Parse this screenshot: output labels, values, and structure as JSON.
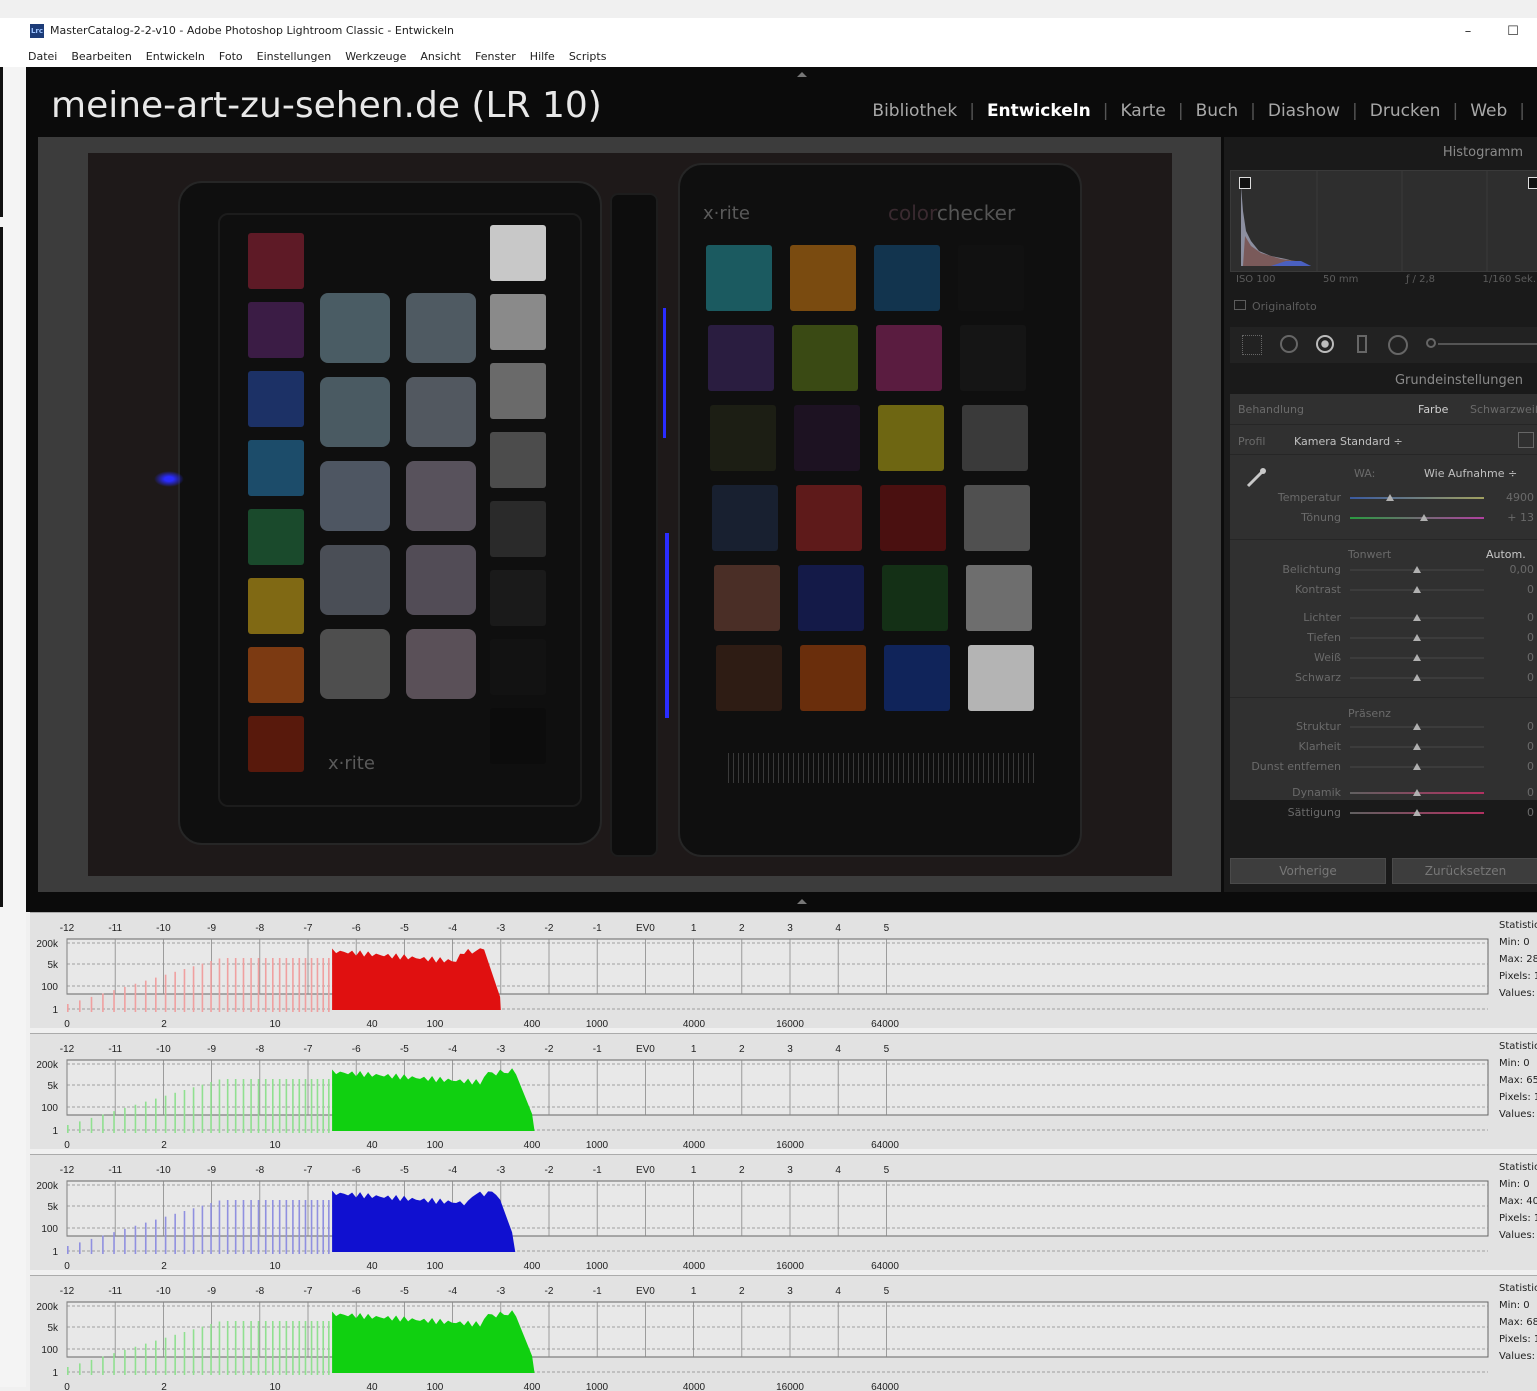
{
  "window": {
    "title": "MasterCatalog-2-2-v10 - Adobe Photoshop Lightroom Classic - Entwickeln",
    "app_icon_text": "Lrc",
    "minimize_glyph": "–",
    "maximize_glyph": "☐"
  },
  "menu": [
    "Datei",
    "Bearbeiten",
    "Entwickeln",
    "Foto",
    "Einstellungen",
    "Werkzeuge",
    "Ansicht",
    "Fenster",
    "Hilfe",
    "Scripts"
  ],
  "identity_plate": "meine-art-zu-sehen.de (LR 10)",
  "modules": [
    {
      "label": "Bibliothek",
      "active": false
    },
    {
      "label": "Entwickeln",
      "active": true
    },
    {
      "label": "Karte",
      "active": false
    },
    {
      "label": "Buch",
      "active": false
    },
    {
      "label": "Diashow",
      "active": false
    },
    {
      "label": "Drucken",
      "active": false
    },
    {
      "label": "Web",
      "active": false
    }
  ],
  "photo": {
    "brand_left": "x·rite",
    "brand_right_a": "color",
    "brand_right_b": "checker",
    "left_card_colors": [
      "#5e1a26",
      "#3b1c45",
      "#1c3166",
      "#1c4c6a",
      "#1a4a2c",
      "#806914",
      "#7c3a12",
      "#58190c"
    ],
    "left_card_grays": [
      "#c8c8c8",
      "#8a8a8a",
      "#6a6a6a",
      "#4c4c4c",
      "#2a2a2a",
      "#1a1a1a",
      "#121212",
      "#0c0c0c"
    ],
    "right_card_colors": [
      [
        "#1b5a60",
        "#7a4b10",
        "#12344e",
        "#111111"
      ],
      [
        "#2a1d40",
        "#3a4a14",
        "#5a1c40",
        "#151515"
      ],
      [
        "#1c1e14",
        "#1d1222",
        "#6e6612",
        "#3a3a3a"
      ],
      [
        "#182030",
        "#5e1a1a",
        "#4a1010",
        "#505050"
      ],
      [
        "#4a2e26",
        "#141a48",
        "#143016",
        "#6e6e6e"
      ],
      [
        "#2e1c14",
        "#6a2e0c",
        "#10245a",
        "#b4b4b4"
      ]
    ]
  },
  "histogram_panel": {
    "title": "Histogramm",
    "info": [
      "ISO 100",
      "50 mm",
      "ƒ / 2,8",
      "1/160 Sek."
    ],
    "original_photo": "Originalfoto"
  },
  "basic_panel": {
    "title": "Grundeinstellungen",
    "treatment_label": "Behandlung",
    "treatment_color": "Farbe",
    "treatment_bw": "Schwarzweiß",
    "profile_label": "Profil",
    "profile_value": "Kamera Standard ÷",
    "wb_label": "WA:",
    "wb_value": "Wie Aufnahme ÷",
    "tone_label": "Tonwert",
    "auto_label": "Autom.",
    "presence_label": "Präsenz",
    "sliders": [
      {
        "label": "Temperatur",
        "value": "4900",
        "pos": 0.3
      },
      {
        "label": "Tönung",
        "value": "+ 13",
        "pos": 0.55
      },
      {
        "label": "Belichtung",
        "value": "0,00",
        "pos": 0.5
      },
      {
        "label": "Kontrast",
        "value": "0",
        "pos": 0.5
      },
      {
        "label": "Lichter",
        "value": "0",
        "pos": 0.5
      },
      {
        "label": "Tiefen",
        "value": "0",
        "pos": 0.5
      },
      {
        "label": "Weiß",
        "value": "0",
        "pos": 0.5
      },
      {
        "label": "Schwarz",
        "value": "0",
        "pos": 0.5
      },
      {
        "label": "Struktur",
        "value": "0",
        "pos": 0.5
      },
      {
        "label": "Klarheit",
        "value": "0",
        "pos": 0.5
      },
      {
        "label": "Dunst entfernen",
        "value": "0",
        "pos": 0.5
      },
      {
        "label": "Dynamik",
        "value": "0",
        "pos": 0.5
      },
      {
        "label": "Sättigung",
        "value": "0",
        "pos": 0.5
      }
    ],
    "previous_button": "Vorherige",
    "reset_button": "Zurücksetzen"
  },
  "histograms": {
    "ev_ticks": [
      "-12",
      "-11",
      "-10",
      "-9",
      "-8",
      "-7",
      "-6",
      "-5",
      "-4",
      "-3",
      "-2",
      "-1",
      "EV0",
      "1",
      "2",
      "3",
      "4",
      "5"
    ],
    "y_ticks": [
      "200k",
      "5k",
      "100",
      "1"
    ],
    "x_ticks": [
      "0",
      "2",
      "10",
      "40",
      "100",
      "400",
      "1000",
      "4000",
      "16000",
      "64000"
    ],
    "stats_lines": [
      "Statistic",
      "Min: 0",
      "Max:",
      "Pixels: 1",
      "Values:"
    ],
    "channels": [
      {
        "color": "#e01010",
        "light": "#f0a0a0",
        "max_text": "Max: 28",
        "end_ev": -3.0
      },
      {
        "color": "#10d010",
        "light": "#90e090",
        "max_text": "Max: 65",
        "end_ev": -2.3
      },
      {
        "color": "#1010d0",
        "light": "#9090e0",
        "max_text": "Max: 40",
        "end_ev": -2.7
      },
      {
        "color": "#10d010",
        "light": "#90e090",
        "max_text": "Max: 68",
        "end_ev": -2.3
      }
    ]
  }
}
